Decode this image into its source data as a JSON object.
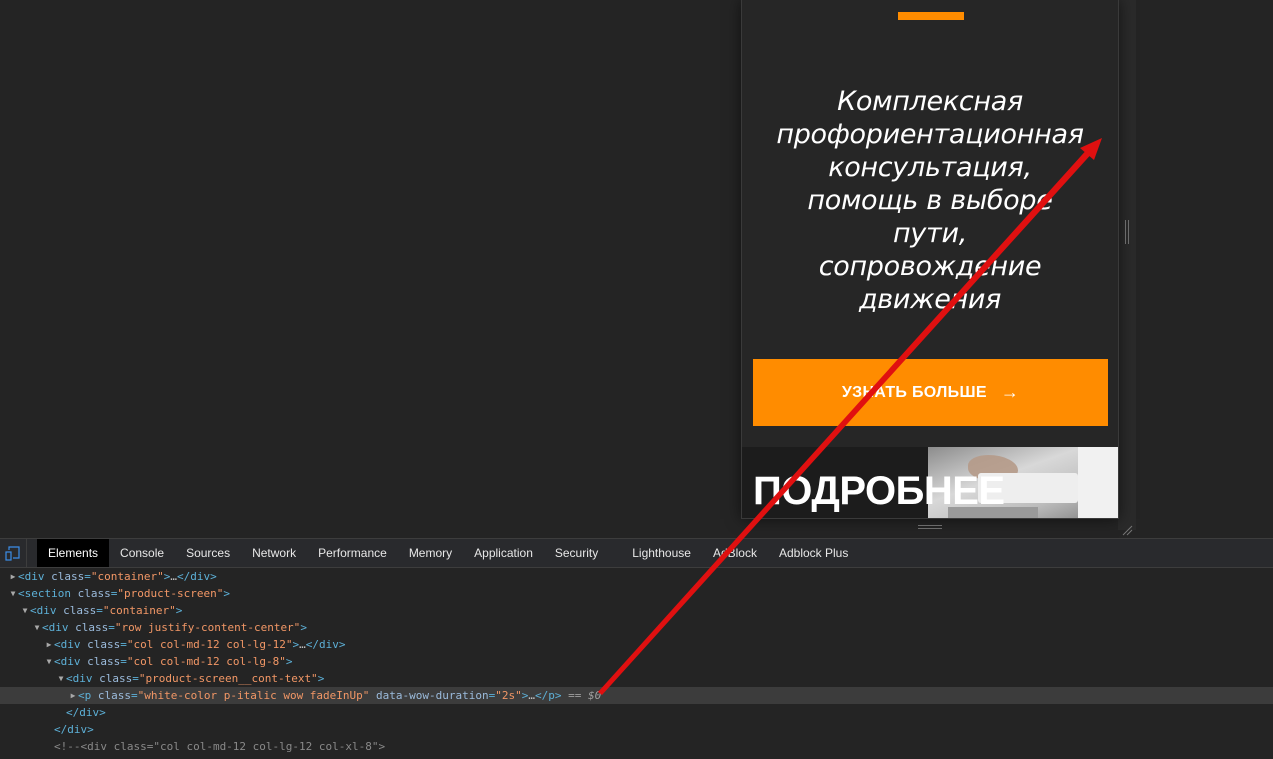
{
  "viewport": {
    "hero_text": "Комплексная\nпрофориентационная\nконсультация,\nпомощь в выборе\nпути,\nсопровождение\nдвижения",
    "cta_label": "УЗНАТЬ БОЛЬШЕ",
    "cta_arrow": "→",
    "section_title": "ПОДРОБНЕЕ",
    "accent_color": "#ff8c00"
  },
  "devtools": {
    "tabs": [
      {
        "label": "Elements",
        "active": true
      },
      {
        "label": "Console"
      },
      {
        "label": "Sources"
      },
      {
        "label": "Network"
      },
      {
        "label": "Performance"
      },
      {
        "label": "Memory"
      },
      {
        "label": "Application"
      },
      {
        "label": "Security"
      },
      {
        "label": "Lighthouse"
      },
      {
        "label": "AdBlock"
      },
      {
        "label": "Adblock Plus"
      }
    ],
    "dom": {
      "line0": {
        "open": "<div ",
        "a1": "class",
        "v1": "\"container\"",
        "close": ">",
        "ell": "…",
        "end": "</div>"
      },
      "line1": {
        "open": "<section ",
        "a1": "class",
        "v1": "\"product-screen\"",
        "close": ">"
      },
      "line2": {
        "open": "<div ",
        "a1": "class",
        "v1": "\"container\"",
        "close": ">"
      },
      "line3": {
        "open": "<div ",
        "a1": "class",
        "v1": "\"row justify-content-center\"",
        "close": ">"
      },
      "line4": {
        "open": "<div ",
        "a1": "class",
        "v1": "\"col col-md-12 col-lg-12\"",
        "close": ">",
        "ell": "…",
        "end": "</div>"
      },
      "line5": {
        "open": "<div ",
        "a1": "class",
        "v1": "\"col col-md-12 col-lg-8\"",
        "close": ">"
      },
      "line6": {
        "open": "<div ",
        "a1": "class",
        "v1": "\"product-screen__cont-text\"",
        "close": ">"
      },
      "line7": {
        "open": "<p ",
        "a1": "class",
        "v1": "\"white-color p-italic wow fadeInUp\"",
        "a2": "data-wow-duration",
        "v2": "\"2s\"",
        "close": ">",
        "ell": "…",
        "end": "</p>",
        "eq": " == ",
        "sel": "$0"
      },
      "line8": {
        "text": "</div>"
      },
      "line9": {
        "text": "</div>"
      },
      "line10": {
        "text": "<!--<div class=\"col col-md-12 col-lg-12 col-xl-8\">"
      }
    }
  }
}
